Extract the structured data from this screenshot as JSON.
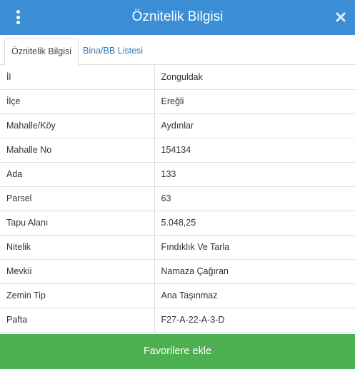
{
  "header": {
    "title": "Öznitelik Bilgisi",
    "menu_icon": "kebab-menu-icon",
    "close_icon": "close-icon"
  },
  "tabs": [
    {
      "label": "Öznitelik Bilgisi",
      "active": true
    },
    {
      "label": "Bina/BB Listesi",
      "active": false
    }
  ],
  "rows": [
    {
      "key": "İl",
      "value": "Zonguldak"
    },
    {
      "key": "İlçe",
      "value": "Ereğli"
    },
    {
      "key": "Mahalle/Köy",
      "value": "Aydınlar"
    },
    {
      "key": "Mahalle No",
      "value": "154134"
    },
    {
      "key": "Ada",
      "value": "133"
    },
    {
      "key": "Parsel",
      "value": "63"
    },
    {
      "key": "Tapu Alanı",
      "value": "5.048,25"
    },
    {
      "key": "Nitelik",
      "value": "Fındıklık Ve Tarla"
    },
    {
      "key": "Mevkii",
      "value": "Namaza Çağıran"
    },
    {
      "key": "Zemin Tip",
      "value": "Ana Taşınmaz"
    },
    {
      "key": "Pafta",
      "value": "F27-A-22-A-3-D"
    }
  ],
  "footer": {
    "button_label": "Favorilere ekle"
  },
  "colors": {
    "header_bg": "#3b8ed4",
    "link": "#337ab7",
    "button_bg": "#4caf50",
    "border": "#dddddd"
  }
}
